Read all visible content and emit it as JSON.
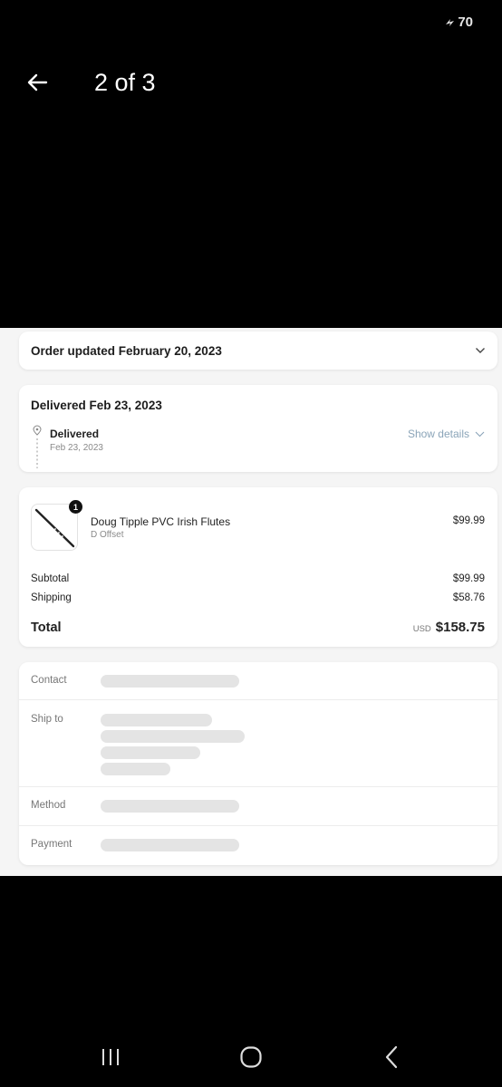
{
  "status_bar": {
    "battery": "70"
  },
  "header": {
    "counter": "2 of 3"
  },
  "order_updated": {
    "title": "Order updated February 20, 2023"
  },
  "delivery": {
    "title": "Delivered Feb 23, 2023",
    "status": "Delivered",
    "date": "Feb 23, 2023",
    "show_details": "Show details"
  },
  "order": {
    "quantity": "1",
    "product_name": "Doug Tipple PVC Irish Flutes",
    "variant": "D Offset",
    "product_price": "$99.99",
    "subtotal_label": "Subtotal",
    "subtotal": "$99.99",
    "shipping_label": "Shipping",
    "shipping": "$58.76",
    "total_label": "Total",
    "currency": "USD",
    "total": "$158.75"
  },
  "info": {
    "contact_label": "Contact",
    "ship_to_label": "Ship to",
    "method_label": "Method",
    "payment_label": "Payment"
  },
  "colors": {
    "link": "#8aa4b8",
    "background": "#f5f5f5",
    "skeleton": "#e4e4e4"
  },
  "icons": [
    "back-arrow-icon",
    "chevron-down-icon",
    "location-pin-icon",
    "recent-apps-icon",
    "home-icon",
    "back-icon"
  ]
}
